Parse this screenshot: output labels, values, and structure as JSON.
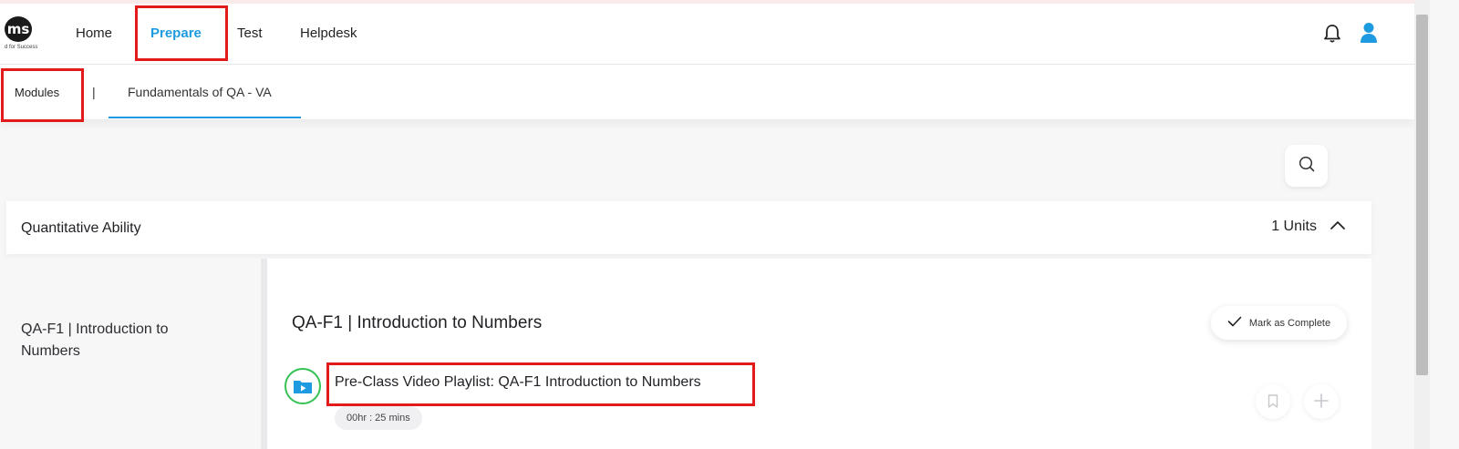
{
  "header": {
    "logo_text": "ms",
    "logo_tagline": "d for Success",
    "nav": [
      {
        "label": "Home"
      },
      {
        "label": "Prepare"
      },
      {
        "label": "Test"
      },
      {
        "label": "Helpdesk"
      }
    ],
    "active_nav": "Prepare",
    "icons": [
      "bell-icon",
      "user-icon"
    ]
  },
  "subnav": {
    "modules_label": "Modules",
    "separator": "|",
    "tab_label": "Fundamentals of QA - VA"
  },
  "search": {
    "icon": "search-icon"
  },
  "section": {
    "title": "Quantitative Ability",
    "units_label": "1 Units",
    "toggle_icon": "chevron-up-icon"
  },
  "left_panel": {
    "items": [
      {
        "label": "QA-F1 | Introduction to Numbers"
      }
    ]
  },
  "unit": {
    "title": "QA-F1 | Introduction to Numbers",
    "mark_complete_label": "Mark as Complete",
    "item": {
      "title": "Pre-Class Video Playlist: QA-F1 Introduction to Numbers",
      "duration": "00hr : 25 mins",
      "icon": "video-playlist-icon"
    },
    "actions": [
      "bookmark-icon",
      "plus-icon"
    ]
  },
  "colors": {
    "accent": "#1e9be0",
    "highlight_box": "#e21a1a",
    "progress_ring": "#35c154"
  }
}
